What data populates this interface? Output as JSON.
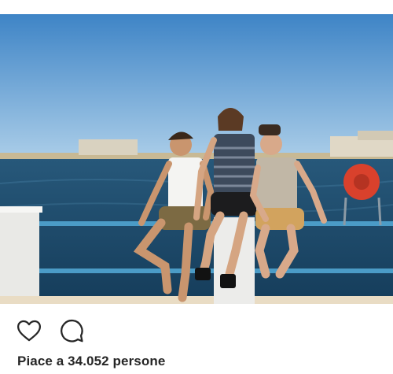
{
  "post": {
    "image": {
      "icon": "photo",
      "sky_top": "#3e84c6",
      "sky_bottom": "#a9cce6",
      "sea": "#1f4d6e"
    },
    "actions": {
      "like_icon": "heart-icon",
      "comment_icon": "speech-bubble-icon"
    },
    "likes_text": "Piace a 34.052 persone"
  }
}
